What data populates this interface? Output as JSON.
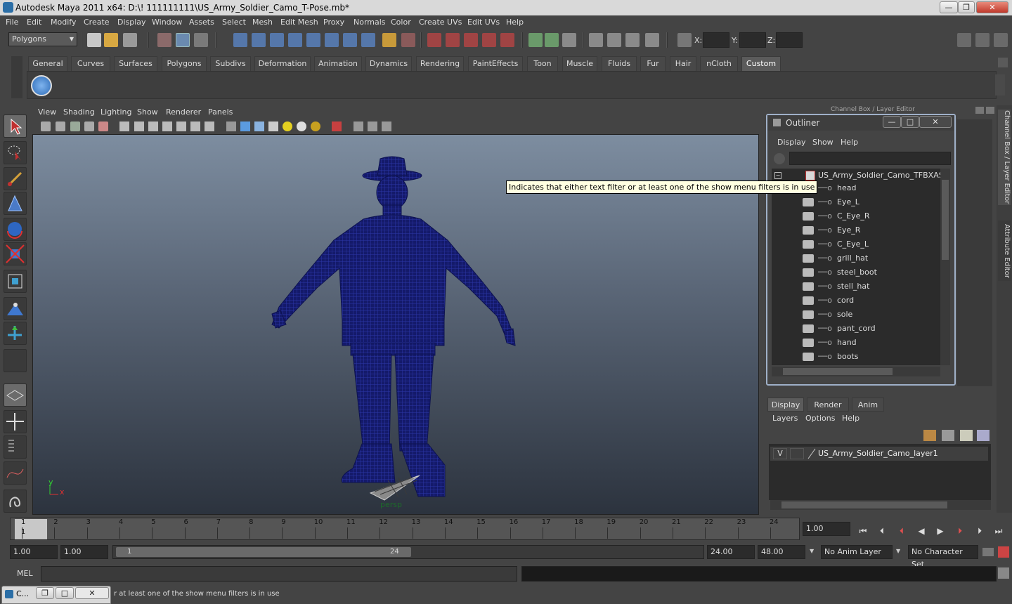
{
  "title": "Autodesk Maya 2011 x64: D:\\! 111111111\\US_Army_Soldier_Camo_T-Pose.mb*",
  "window_controls": {
    "minimize": "—",
    "maximize": "❐",
    "close": "✕"
  },
  "menubar": [
    "File",
    "Edit",
    "Modify",
    "Create",
    "Display",
    "Window",
    "Assets",
    "Select",
    "Mesh",
    "Edit Mesh",
    "Proxy",
    "Normals",
    "Color",
    "Create UVs",
    "Edit UVs",
    "Help"
  ],
  "statusline": {
    "mode": "Polygons",
    "x_label": "X:",
    "y_label": "Y:",
    "z_label": "Z:"
  },
  "shelf": {
    "tabs": [
      "General",
      "Curves",
      "Surfaces",
      "Polygons",
      "Subdivs",
      "Deformation",
      "Animation",
      "Dynamics",
      "Rendering",
      "PaintEffects",
      "Toon",
      "Muscle",
      "Fluids",
      "Fur",
      "Hair",
      "nCloth",
      "Custom"
    ],
    "active_tab": "Custom"
  },
  "viewport": {
    "menus": [
      "View",
      "Shading",
      "Lighting",
      "Show",
      "Renderer",
      "Panels"
    ],
    "camera_label": "persp",
    "axis_y": "y",
    "axis_x": "x"
  },
  "channel_box": {
    "title": "Channel Box / Layer Editor",
    "side_tab_1": "Channel Box / Layer Editor",
    "side_tab_2": "Attribute Editor"
  },
  "outliner": {
    "title": "Outliner",
    "menus": [
      "Display",
      "Show",
      "Help"
    ],
    "root": "US_Army_Soldier_Camo_TFBXASC",
    "items": [
      "head",
      "Eye_L",
      "C_Eye_R",
      "Eye_R",
      "C_Eye_L",
      "grill_hat",
      "steel_boot",
      "stell_hat",
      "cord",
      "sole",
      "pant_cord",
      "hand",
      "boots"
    ]
  },
  "tooltip": "Indicates that either text filter or at least one of the show menu filters is in use",
  "layer_editor": {
    "tabs": [
      "Display",
      "Render",
      "Anim"
    ],
    "active_tab": "Display",
    "menus": [
      "Layers",
      "Options",
      "Help"
    ],
    "layer": {
      "visibility": "V",
      "name": "US_Army_Soldier_Camo_layer1"
    }
  },
  "timeline": {
    "ticks": [
      "1",
      "2",
      "3",
      "4",
      "5",
      "6",
      "7",
      "8",
      "9",
      "10",
      "11",
      "12",
      "13",
      "14",
      "15",
      "16",
      "17",
      "18",
      "19",
      "20",
      "21",
      "22",
      "23",
      "24"
    ],
    "current_frame_marker": "1",
    "current_time": "1.00"
  },
  "range_slider": {
    "start_time": "1.00",
    "playback_start": "1.00",
    "range_start_label": "1",
    "range_end_label": "24",
    "playback_end": "24.00",
    "end_time": "48.00",
    "anim_layer": "No Anim Layer",
    "character_set": "No Character Set"
  },
  "command_line": {
    "label": "MEL"
  },
  "help_line": {
    "text": "r at least one of the show menu filters is in use"
  },
  "minimized_window": {
    "label": "C...",
    "restore": "❐",
    "maximize": "□",
    "close": "✕"
  }
}
